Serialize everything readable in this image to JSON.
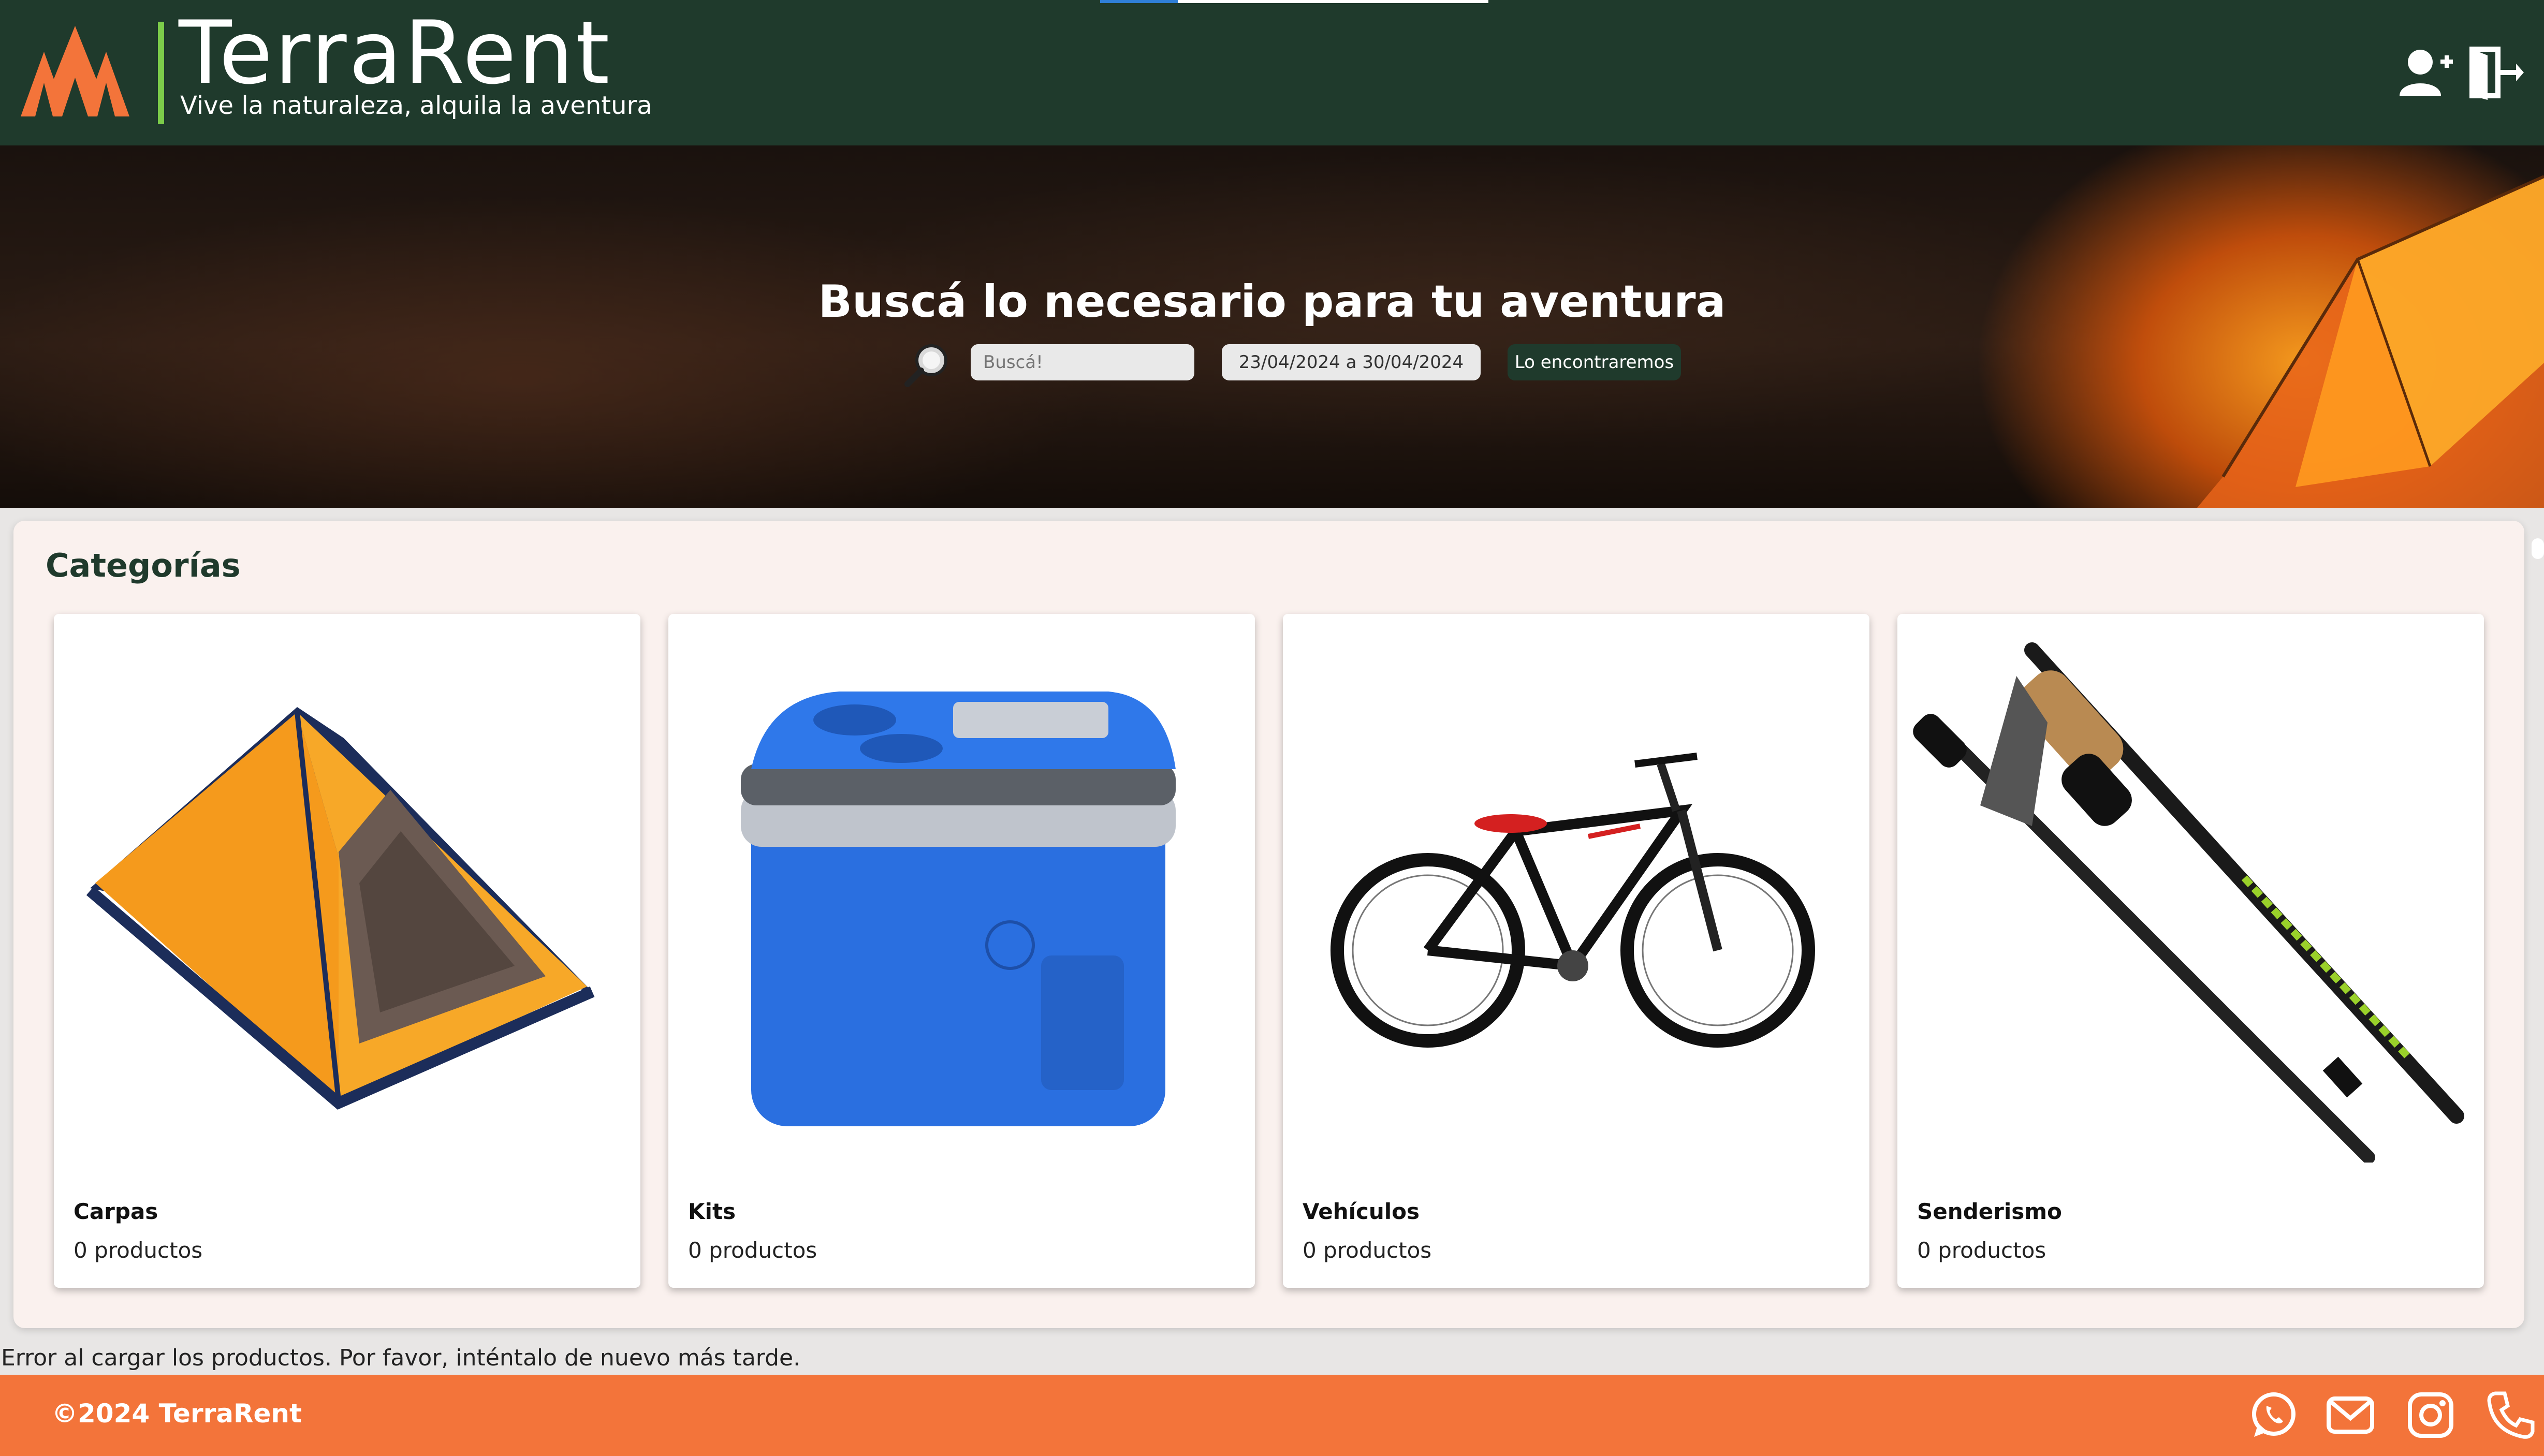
{
  "brand": {
    "name": "TerraRent",
    "tagline": "Vive la naturaleza, alquila la aventura"
  },
  "header": {
    "icons": [
      "user-plus-icon",
      "logout-icon"
    ]
  },
  "hero": {
    "title": "Buscá lo necesario para tu aventura",
    "search_placeholder": "Buscá!",
    "date_range": "23/04/2024 a 30/04/2024",
    "search_button": "Lo encontraremos"
  },
  "categories": {
    "title": "Categorías",
    "items": [
      {
        "name": "Carpas",
        "count": "0 productos",
        "image": "tent"
      },
      {
        "name": "Kits",
        "count": "0 productos",
        "image": "cooler"
      },
      {
        "name": "Vehículos",
        "count": "0 productos",
        "image": "bicycle"
      },
      {
        "name": "Senderismo",
        "count": "0 productos",
        "image": "trekking-poles"
      }
    ]
  },
  "error_message": "Error al cargar los productos. Por favor, inténtalo de nuevo más tarde.",
  "footer": {
    "copyright": "©2024 TerraRent",
    "icons": [
      "whatsapp-icon",
      "mail-icon",
      "instagram-icon",
      "phone-icon"
    ]
  },
  "colors": {
    "header_bg": "#1f3a2c",
    "accent_orange": "#f3743a",
    "logo_green": "#7ccc4a",
    "panel_bg": "#faf1ee"
  }
}
